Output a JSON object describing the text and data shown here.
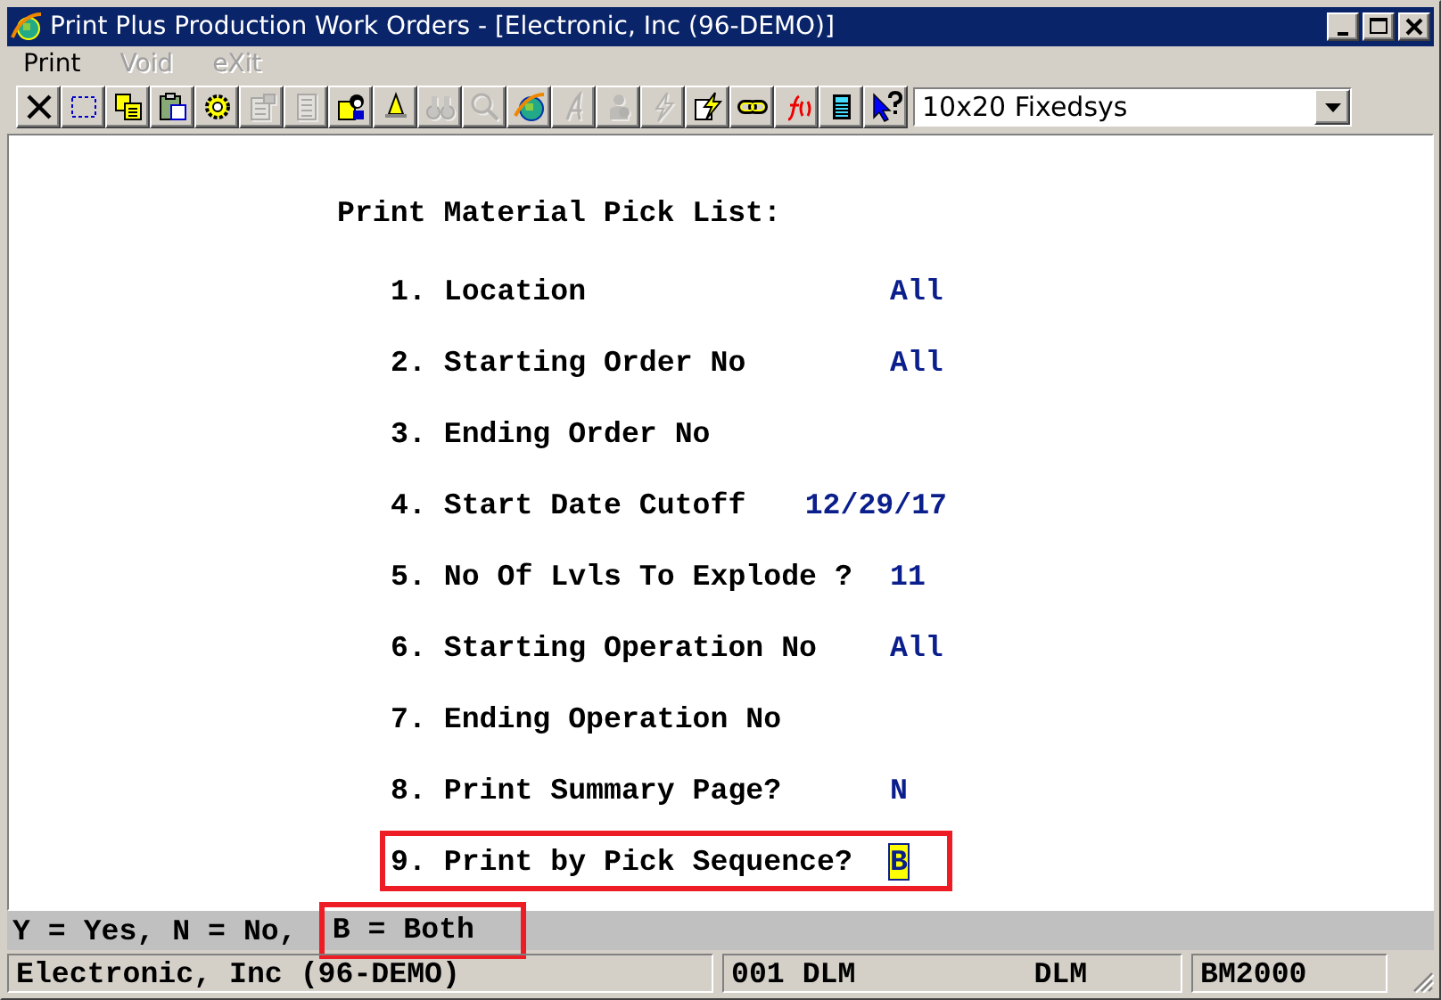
{
  "window": {
    "title": "Print Plus Production Work Orders - [Electronic, Inc (96-DEMO)]"
  },
  "menu": [
    {
      "label": "Print",
      "disabled": false
    },
    {
      "label": "Void",
      "disabled": true
    },
    {
      "label": "eXit",
      "disabled": true
    }
  ],
  "toolbar": [
    {
      "kind": "close",
      "disabled": false
    },
    {
      "kind": "select",
      "disabled": false
    },
    {
      "kind": "copy",
      "disabled": false
    },
    {
      "kind": "paste",
      "disabled": false
    },
    {
      "kind": "gear",
      "disabled": false
    },
    {
      "kind": "properties",
      "disabled": true
    },
    {
      "kind": "document",
      "disabled": true
    },
    {
      "kind": "person",
      "disabled": false
    },
    {
      "kind": "bell",
      "disabled": false
    },
    {
      "kind": "binoculars",
      "disabled": true
    },
    {
      "kind": "magnifier",
      "disabled": true
    },
    {
      "kind": "globe",
      "disabled": false
    },
    {
      "kind": "script",
      "disabled": true
    },
    {
      "kind": "figure",
      "disabled": true
    },
    {
      "kind": "lightning",
      "disabled": true
    },
    {
      "kind": "lightning-doc",
      "disabled": false
    },
    {
      "kind": "link",
      "disabled": false
    },
    {
      "kind": "function",
      "disabled": false
    },
    {
      "kind": "calculator",
      "disabled": false
    },
    {
      "kind": "help",
      "disabled": false
    }
  ],
  "font_select": {
    "value": "10x20 Fixedsys"
  },
  "form": {
    "title": "Print Material Pick List:",
    "fields": [
      {
        "label": "1. Location",
        "value": "All",
        "highlighted": false,
        "focused": false
      },
      {
        "label": "2. Starting Order No",
        "value": "All",
        "highlighted": false,
        "focused": false
      },
      {
        "label": "3. Ending Order No",
        "highlighted": false
      },
      {
        "label": "4. Start Date Cutoff",
        "value": "12/29/17",
        "highlighted": false,
        "focused": false
      },
      {
        "label": "5. No Of Lvls To Explode ?",
        "value": "11",
        "highlighted": false,
        "focused": false
      },
      {
        "label": "6. Starting Operation No",
        "value": "All",
        "highlighted": false,
        "focused": false
      },
      {
        "label": "7. Ending Operation No",
        "highlighted": false
      },
      {
        "label": "8. Print Summary Page?",
        "value": "N",
        "highlighted": false,
        "focused": false
      },
      {
        "label": "9. Print by Pick Sequence?",
        "value": "B",
        "highlighted": true,
        "focused": true
      }
    ]
  },
  "hint": [
    {
      "text": "Y = Yes, N = No,",
      "highlighted": false
    },
    {
      "text": "B = Both",
      "highlighted": true
    }
  ],
  "status_bar": [
    {
      "texts": [
        "Electronic, Inc (96-DEMO)"
      ]
    },
    {
      "texts": [
        "001 DLM",
        "DLM"
      ]
    },
    {
      "texts": [
        "BM2000"
      ]
    }
  ]
}
